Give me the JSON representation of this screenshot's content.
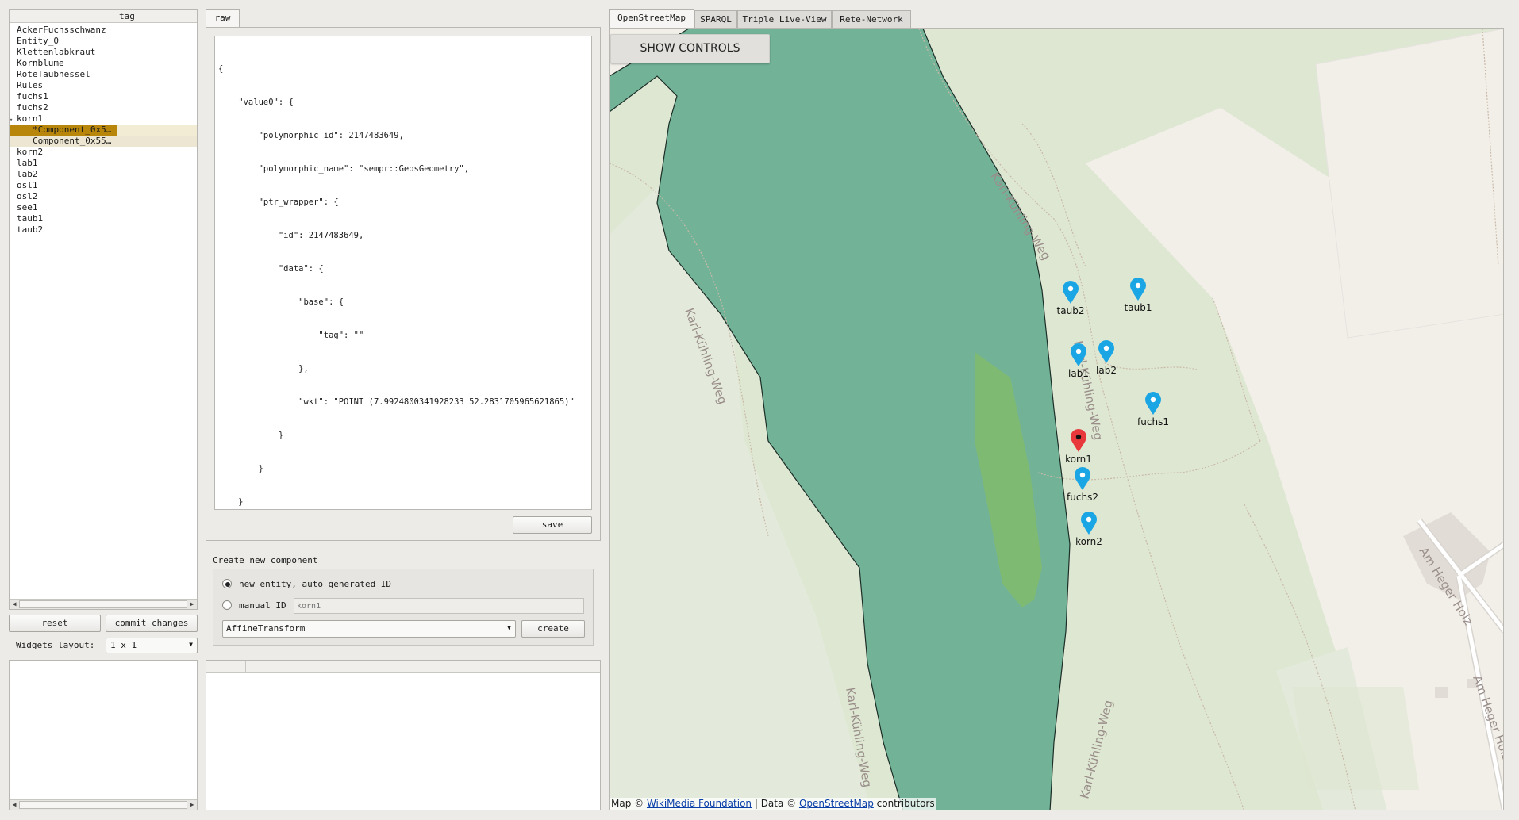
{
  "tree": {
    "header_col2": "tag",
    "items": [
      {
        "label": "AckerFuchsschwanz"
      },
      {
        "label": "Entity_0"
      },
      {
        "label": "Klettenlabkraut"
      },
      {
        "label": "Kornblume"
      },
      {
        "label": "RoteTaubnessel"
      },
      {
        "label": "Rules"
      },
      {
        "label": "fuchs1"
      },
      {
        "label": "fuchs2"
      },
      {
        "label": "korn1"
      },
      {
        "label": "*Component_0x5…"
      },
      {
        "label": "Component_0x55…"
      },
      {
        "label": "korn2"
      },
      {
        "label": "lab1"
      },
      {
        "label": "lab2"
      },
      {
        "label": "osl1"
      },
      {
        "label": "osl2"
      },
      {
        "label": "see1"
      },
      {
        "label": "taub1"
      },
      {
        "label": "taub2"
      }
    ]
  },
  "left_buttons": {
    "reset": "reset",
    "commit": "commit changes",
    "layout_label": "Widgets layout:",
    "layout_value": "1 x 1"
  },
  "editor": {
    "tab": "raw",
    "lines": [
      "{",
      "    \"value0\": {",
      "        \"polymorphic_id\": 2147483649,",
      "        \"polymorphic_name\": \"sempr::GeosGeometry\",",
      "        \"ptr_wrapper\": {",
      "            \"id\": 2147483649,",
      "            \"data\": {",
      "                \"base\": {",
      "                    \"tag\": \"\"",
      "                },",
      "                \"wkt\": \"POINT (7.9924800341928233 52.2831705965621865)\"",
      "            }",
      "        }",
      "    }",
      "}"
    ],
    "save": "save"
  },
  "create": {
    "title": "Create new component",
    "radio_auto": "new entity, auto generated ID",
    "radio_manual": "manual ID",
    "manual_placeholder": "korn1",
    "type_value": "AffineTransform",
    "create_button": "create"
  },
  "map_tabs": [
    "OpenStreetMap",
    "SPARQL",
    "Triple Live-View",
    "Rete-Network"
  ],
  "map": {
    "show_controls": "SHOW CONTROLS",
    "street_name": "Karl-Kühling-Weg",
    "street_name2": "Am Heger Holz",
    "markers": [
      {
        "label": "taub2",
        "color": "#1aa6e4"
      },
      {
        "label": "taub1",
        "color": "#1aa6e4"
      },
      {
        "label": "lab1",
        "color": "#1aa6e4"
      },
      {
        "label": "lab2",
        "color": "#1aa6e4"
      },
      {
        "label": "fuchs1",
        "color": "#1aa6e4"
      },
      {
        "label": "korn1",
        "color": "#e8383b"
      },
      {
        "label": "fuchs2",
        "color": "#1aa6e4"
      },
      {
        "label": "korn2",
        "color": "#1aa6e4"
      }
    ],
    "attribution": {
      "prefix": "Map © ",
      "link1": "WikiMedia Foundation",
      "mid": " | Data © ",
      "link2": "OpenStreetMap",
      "suffix": " contributors"
    }
  }
}
